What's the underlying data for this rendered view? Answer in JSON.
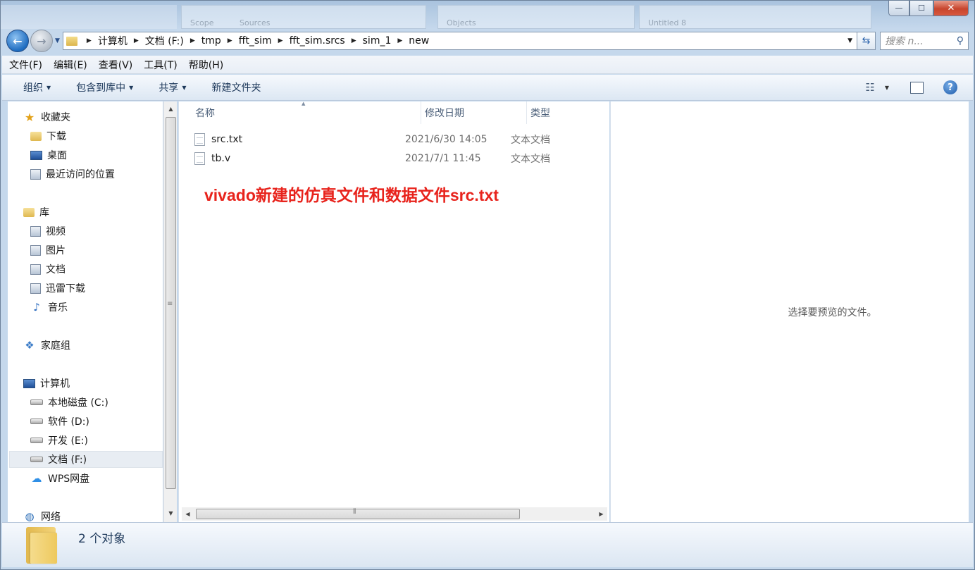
{
  "window": {
    "title": "Untitled 8",
    "caption": {
      "minimize": "—",
      "maximize": "☐",
      "close": "✕"
    }
  },
  "background_ghost": {
    "scope": "Scope",
    "sources": "Sources",
    "objects": "Objects",
    "untitled": "Untitled 8"
  },
  "address": {
    "breadcrumbs": [
      "计算机",
      "文档 (F:)",
      "tmp",
      "fft_sim",
      "fft_sim.srcs",
      "sim_1",
      "new"
    ],
    "search_placeholder": "搜索 n..."
  },
  "menu": [
    "文件(F)",
    "编辑(E)",
    "查看(V)",
    "工具(T)",
    "帮助(H)"
  ],
  "commands": {
    "organize": "组织",
    "include": "包含到库中",
    "share": "共享",
    "new_folder": "新建文件夹"
  },
  "nav": {
    "favorites": "收藏夹",
    "downloads": "下载",
    "desktop": "桌面",
    "recent": "最近访问的位置",
    "libraries": "库",
    "videos": "视频",
    "pictures": "图片",
    "documents": "文档",
    "xunlei": "迅雷下载",
    "music": "音乐",
    "homegroup": "家庭组",
    "computer": "计算机",
    "drive_c": "本地磁盘 (C:)",
    "drive_d": "软件 (D:)",
    "drive_e": "开发 (E:)",
    "drive_f": "文档 (F:)",
    "wps": "WPS网盘",
    "network": "网络"
  },
  "columns": {
    "name": "名称",
    "date": "修改日期",
    "type": "类型"
  },
  "files": [
    {
      "name": "src.txt",
      "date": "2021/6/30 14:05",
      "type": "文本文档"
    },
    {
      "name": "tb.v",
      "date": "2021/7/1 11:45",
      "type": "文本文档"
    }
  ],
  "annotation": "vivado新建的仿真文件和数据文件src.txt",
  "preview_message": "选择要预览的文件。",
  "status": {
    "count": "2 个对象"
  },
  "colors": {
    "annotation": "#e8231c",
    "accent": "#1e6cc0"
  }
}
